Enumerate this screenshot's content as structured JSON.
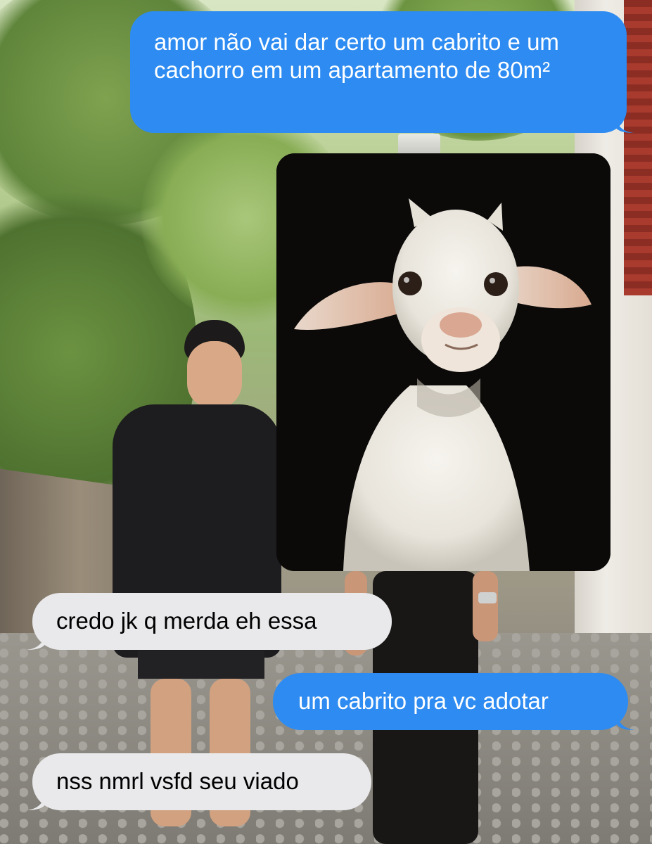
{
  "conversation": {
    "messages": [
      {
        "direction": "sent",
        "text": "amor não vai dar certo um cabrito e um cachorro em um apartamento de 80m²"
      },
      {
        "direction": "sent",
        "type": "image",
        "image_subject": "goat"
      },
      {
        "direction": "received",
        "text": "credo jk q merda eh essa"
      },
      {
        "direction": "sent",
        "text": "um cabrito pra vc adotar"
      },
      {
        "direction": "received",
        "text": "nss nmrl vsfd seu viado"
      }
    ]
  },
  "colors": {
    "sent_bubble": "#2d8bf1",
    "received_bubble": "#e9e9eb",
    "sent_text": "#ffffff",
    "received_text": "#000000"
  }
}
